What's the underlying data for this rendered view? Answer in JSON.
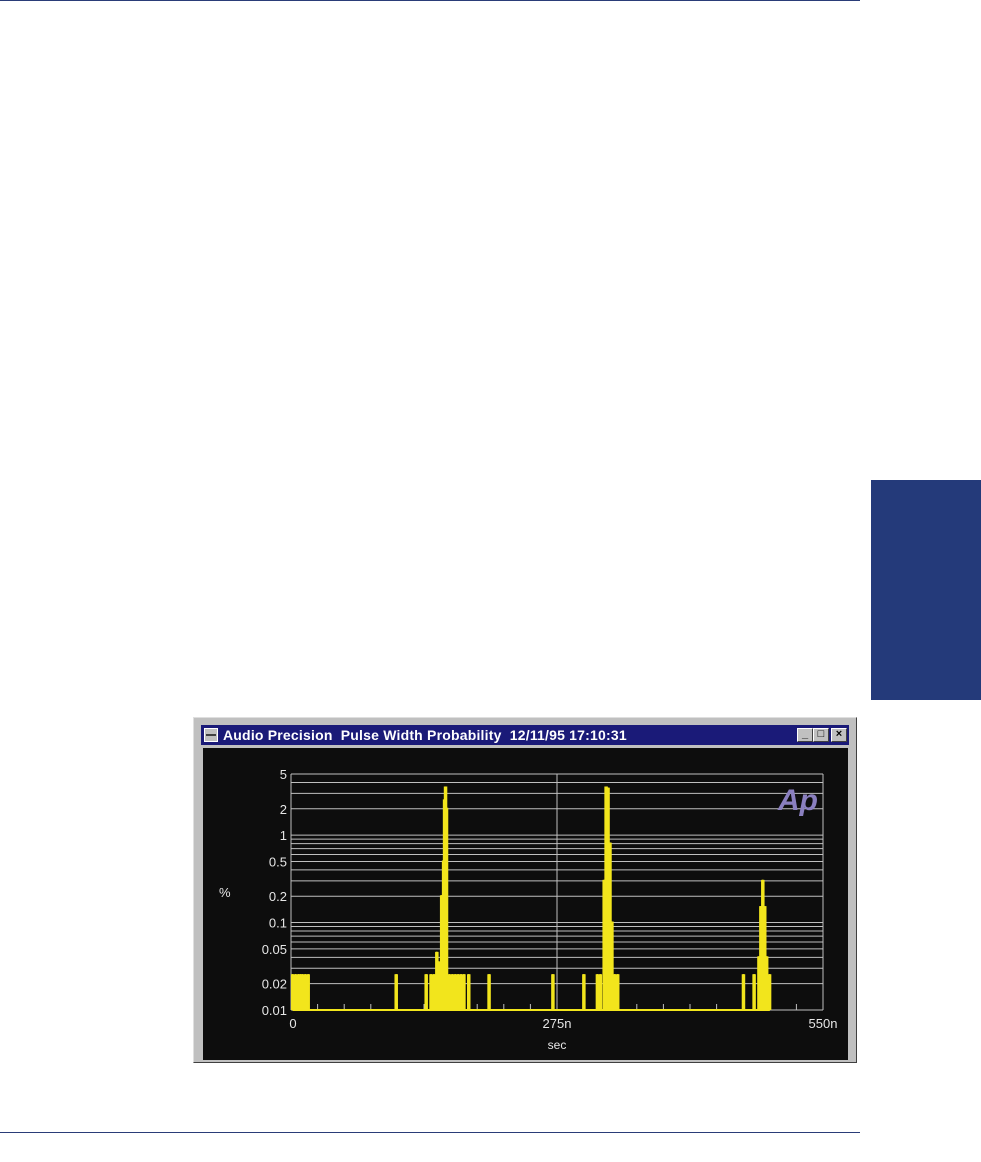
{
  "window": {
    "title": "Audio Precision  Pulse Width Probability  12/11/95 17:10:31",
    "buttons": {
      "minimize": "_",
      "maximize": "□",
      "close": "×"
    },
    "logo_text": "Ap"
  },
  "colors": {
    "accent_blue": "#243a7a",
    "trace": "#f2e51c",
    "plot_background": "#0d0d0d",
    "grid": "#bfbfbf"
  },
  "chart_data": {
    "type": "line",
    "title": "",
    "xlabel": "sec",
    "ylabel": "%",
    "yscale": "log",
    "grid": true,
    "xlim": [
      0,
      550
    ],
    "x_units": "ns",
    "ylim": [
      0.01,
      5
    ],
    "x_tick_labels": [
      "0",
      "275n",
      "550n"
    ],
    "x_tick_values": [
      0,
      275,
      550
    ],
    "y_tick_labels": [
      "5",
      "2",
      "1",
      "0.5",
      "0.2",
      "0.1",
      "0.05",
      "0.02",
      "0.01"
    ],
    "y_tick_values": [
      5,
      2,
      1,
      0.5,
      0.2,
      0.1,
      0.05,
      0.02,
      0.01
    ],
    "series": [
      {
        "points": [
          [
            1,
            0.025
          ],
          [
            4,
            0.025
          ],
          [
            7,
            0.025
          ],
          [
            9,
            0.025
          ],
          [
            11,
            0.025
          ],
          [
            14,
            0.025
          ],
          [
            17,
            0.025
          ],
          [
            108,
            0.025
          ],
          [
            139,
            0.025
          ],
          [
            144,
            0.025
          ],
          [
            147,
            0.025
          ],
          [
            150,
            0.045
          ],
          [
            152,
            0.035
          ],
          [
            155,
            0.2
          ],
          [
            157,
            0.5
          ],
          [
            158,
            2.5
          ],
          [
            159,
            3.5
          ],
          [
            160,
            2
          ],
          [
            163,
            0.025
          ],
          [
            166,
            0.025
          ],
          [
            169,
            0.025
          ],
          [
            172,
            0.025
          ],
          [
            175,
            0.025
          ],
          [
            178,
            0.025
          ],
          [
            183,
            0.025
          ],
          [
            204,
            0.025
          ],
          [
            270,
            0.025
          ],
          [
            302,
            0.025
          ],
          [
            316,
            0.025
          ],
          [
            319,
            0.025
          ],
          [
            323,
            0.3
          ],
          [
            325,
            3.5
          ],
          [
            327,
            3.4
          ],
          [
            329,
            0.8
          ],
          [
            331,
            0.1
          ],
          [
            334,
            0.025
          ],
          [
            337,
            0.025
          ],
          [
            467,
            0.025
          ],
          [
            478,
            0.025
          ],
          [
            483,
            0.04
          ],
          [
            485,
            0.15
          ],
          [
            487,
            0.3
          ],
          [
            489,
            0.15
          ],
          [
            491,
            0.04
          ],
          [
            494,
            0.025
          ]
        ]
      }
    ]
  }
}
